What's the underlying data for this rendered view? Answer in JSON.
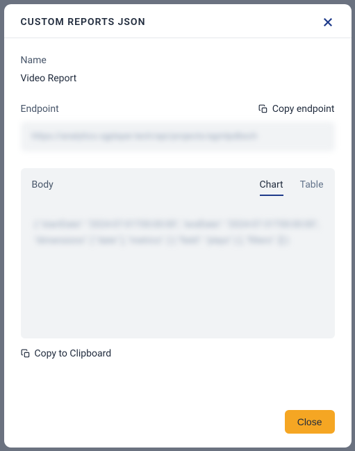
{
  "header": {
    "title": "CUSTOM REPORTS JSON"
  },
  "name": {
    "label": "Name",
    "value": "Video Report"
  },
  "endpoint": {
    "label": "Endpoint",
    "copy_label": "Copy endpoint",
    "value": "https://analytics.vgplayer.tech/api/projects/agmlpdbxch"
  },
  "body": {
    "label": "Body",
    "tabs": {
      "chart": "Chart",
      "table": "Table"
    },
    "content": "{ \"startDate\": \"2024-07-01T00:00:00\", \"endDate\": \"2024-07-31T00:00:00\", \"dimensions\": [ \"date\" ], \"metrics\": [ { \"field\": \"plays\" } ], \"filters\": [] }"
  },
  "actions": {
    "copy_clipboard": "Copy to Clipboard",
    "close": "Close"
  }
}
